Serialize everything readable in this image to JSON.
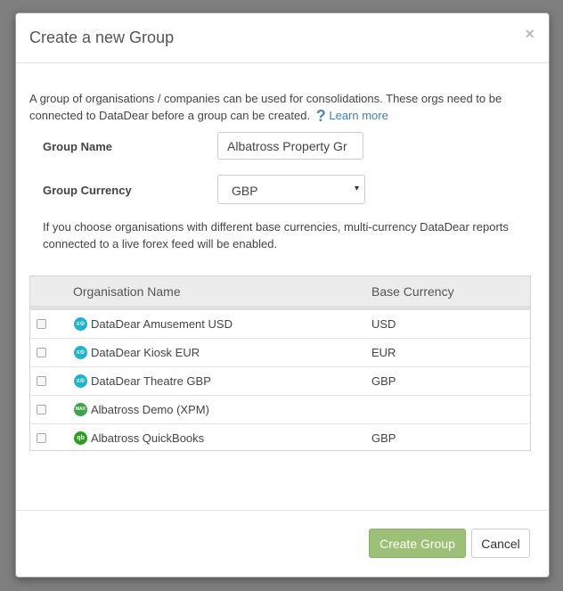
{
  "modal": {
    "title": "Create a new Group",
    "close_label": "×"
  },
  "intro": {
    "text": "A group of organisations / companies can be used for consolidations. These orgs need to be connected to DataDear before a group can be created.",
    "help_glyph": "?",
    "link_text": "Learn more"
  },
  "form": {
    "group_name_label": "Group Name",
    "group_name_value": "Albatross Property Gr",
    "group_currency_label": "Group Currency",
    "group_currency_value": "GBP",
    "select_caret": "▾"
  },
  "note": "If you choose organisations with different base currencies, multi-currency DataDear reports connected to a live forex feed will be enabled.",
  "table": {
    "headers": {
      "name": "Organisation Name",
      "currency": "Base Currency"
    },
    "rows": [
      {
        "name": "DataDear Amusement USD",
        "currency": "USD",
        "icon": "xero-icon",
        "icon_text": "x⊙"
      },
      {
        "name": "DataDear Kiosk EUR",
        "currency": "EUR",
        "icon": "xero-icon",
        "icon_text": "x⊙"
      },
      {
        "name": "DataDear Theatre GBP",
        "currency": "GBP",
        "icon": "xero-icon",
        "icon_text": "x⊙"
      },
      {
        "name": "Albatross Demo (XPM)",
        "currency": "",
        "icon": "xpm-max-icon",
        "icon_text": "MAX"
      },
      {
        "name": "Albatross QuickBooks",
        "currency": "GBP",
        "icon": "quickbooks-icon",
        "icon_text": "qb"
      }
    ]
  },
  "footer": {
    "create_label": "Create Group",
    "cancel_label": "Cancel"
  },
  "colors": {
    "primary_button": "#9cc075",
    "link": "#3a7fc1",
    "xero": "#1ab4d7",
    "quickbooks": "#2ca01c"
  }
}
